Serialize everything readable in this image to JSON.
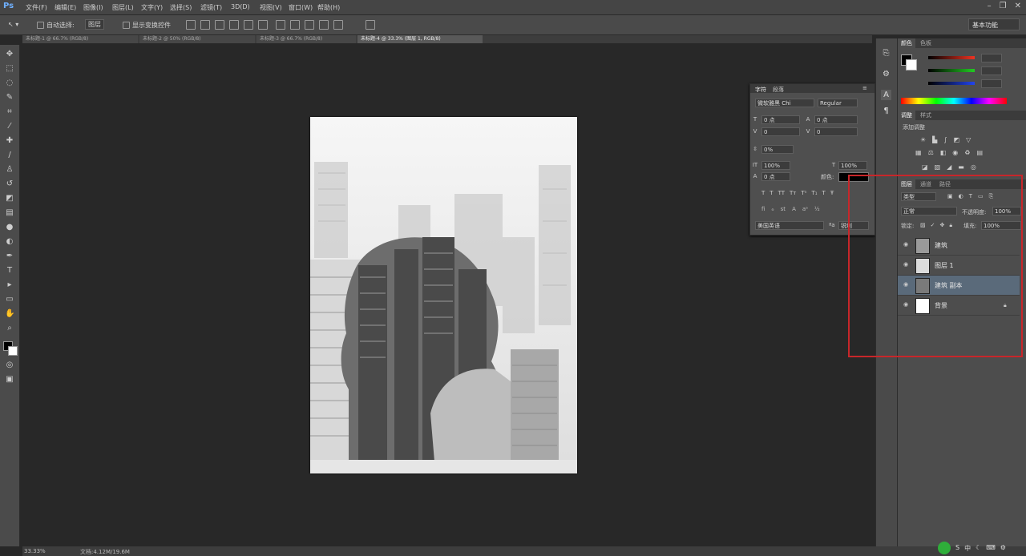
{
  "app": {
    "logo": "Ps"
  },
  "menu": [
    "文件(F)",
    "编辑(E)",
    "图像(I)",
    "图层(L)",
    "文字(Y)",
    "选择(S)",
    "滤镜(T)",
    "3D(D)",
    "视图(V)",
    "窗口(W)",
    "帮助(H)"
  ],
  "options": {
    "auto_select": "自动选择:",
    "layer_select": "图层",
    "show_transform": "显示变换控件",
    "workspace": "基本功能"
  },
  "tabs": [
    "未标题-1 @ 66.7% (RGB/8)",
    "未标题-2 @ 50% (RGB/8)",
    "未标题-3 @ 66.7% (RGB/8)",
    "未标题-4 @ 33.3% (图层 1, RGB/8)"
  ],
  "character": {
    "tab_char": "字符",
    "tab_para": "段落",
    "font_family": "微软雅黑 Chi",
    "font_style": "Regular",
    "size": "0 点",
    "leading": "0 点",
    "tracking": "0",
    "kerning": "0",
    "vscale_label": "0%",
    "vscale": "100%",
    "hscale": "100%",
    "baseline": "0 点",
    "color_label": "颜色:",
    "language": "美国英语",
    "aa": "锐利"
  },
  "color_panel": {
    "tab_color": "颜色",
    "tab_swatches": "色板"
  },
  "adjustments": {
    "tab": "调整",
    "tab2": "样式",
    "title": "添加调整"
  },
  "layers_panel": {
    "tab_layers": "图层",
    "tab_channels": "通道",
    "tab_paths": "路径",
    "kind": "类型",
    "blend": "正常",
    "opacity_label": "不透明度:",
    "opacity": "100%",
    "lock_label": "锁定:",
    "fill_label": "填充:",
    "fill": "100%",
    "layers": [
      {
        "name": "建筑",
        "selected": false,
        "thumb": "#9a9a9a"
      },
      {
        "name": "图层 1",
        "selected": false,
        "thumb": "#dcdcdc"
      },
      {
        "name": "建筑 副本",
        "selected": true,
        "thumb": "#7a7a7a"
      },
      {
        "name": "背景",
        "selected": false,
        "thumb": "#ffffff"
      }
    ]
  },
  "status": {
    "zoom": "33.33%",
    "doc": "文档:4.12M/19.6M"
  }
}
